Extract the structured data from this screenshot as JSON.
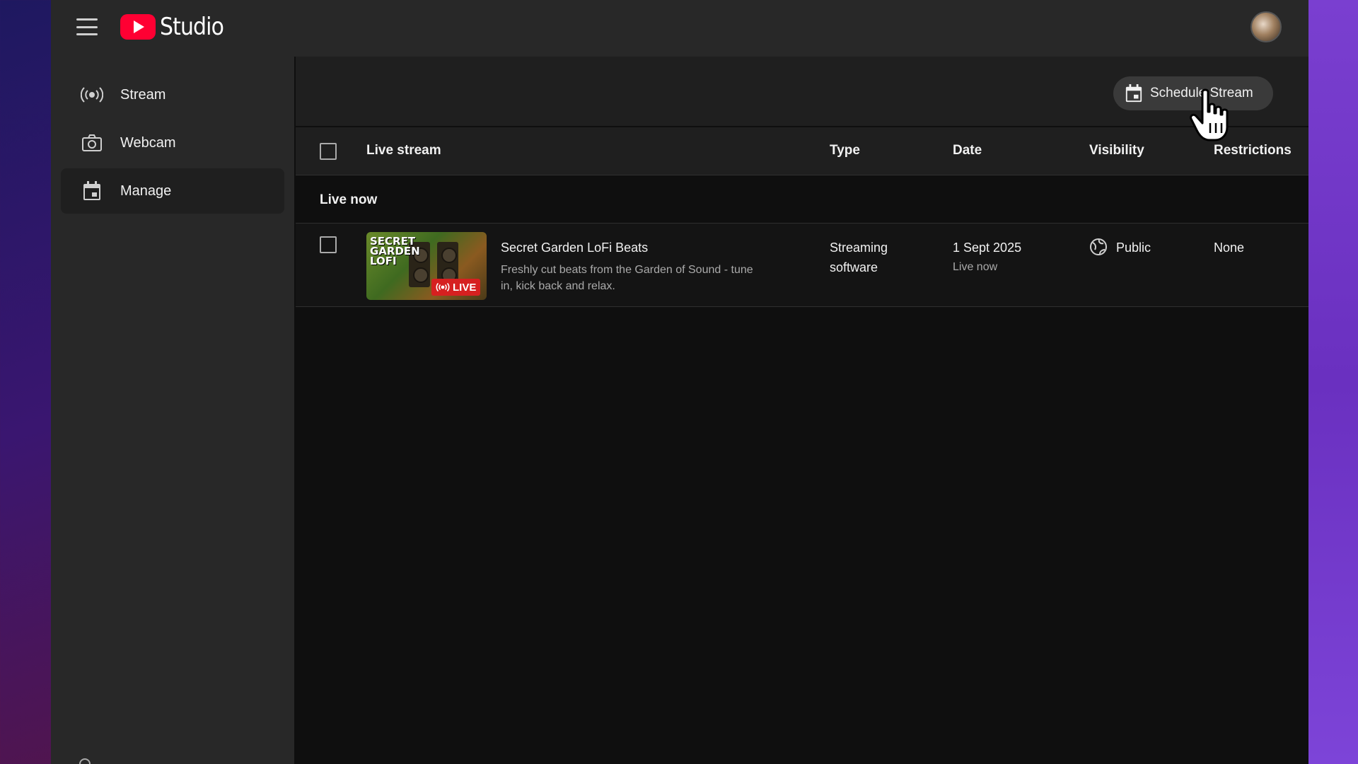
{
  "app": {
    "logo_text": "Studio",
    "brand_color": "#ff0033"
  },
  "sidebar": {
    "items": [
      {
        "label": "Stream",
        "icon": "broadcast-icon",
        "active": false
      },
      {
        "label": "Webcam",
        "icon": "camera-icon",
        "active": false
      },
      {
        "label": "Manage",
        "icon": "calendar-icon",
        "active": true
      }
    ]
  },
  "toolbar": {
    "schedule_label": "Schedule Stream",
    "schedule_icon": "calendar-icon"
  },
  "table": {
    "columns": [
      "Live stream",
      "Type",
      "Date",
      "Visibility",
      "Restrictions"
    ],
    "section_label": "Live now",
    "rows": [
      {
        "thumbnail_title": "SECRET GARDEN LOFI",
        "thumbnail_badge": "LIVE",
        "title": "Secret Garden LoFi Beats",
        "description": "Freshly cut beats from the Garden of Sound - tune in, kick back and relax.",
        "type_line1": "Streaming",
        "type_line2": "software",
        "date": "1 Sept 2025",
        "date_status": "Live now",
        "visibility": "Public",
        "visibility_icon": "globe-icon",
        "restrictions": "None"
      }
    ]
  }
}
